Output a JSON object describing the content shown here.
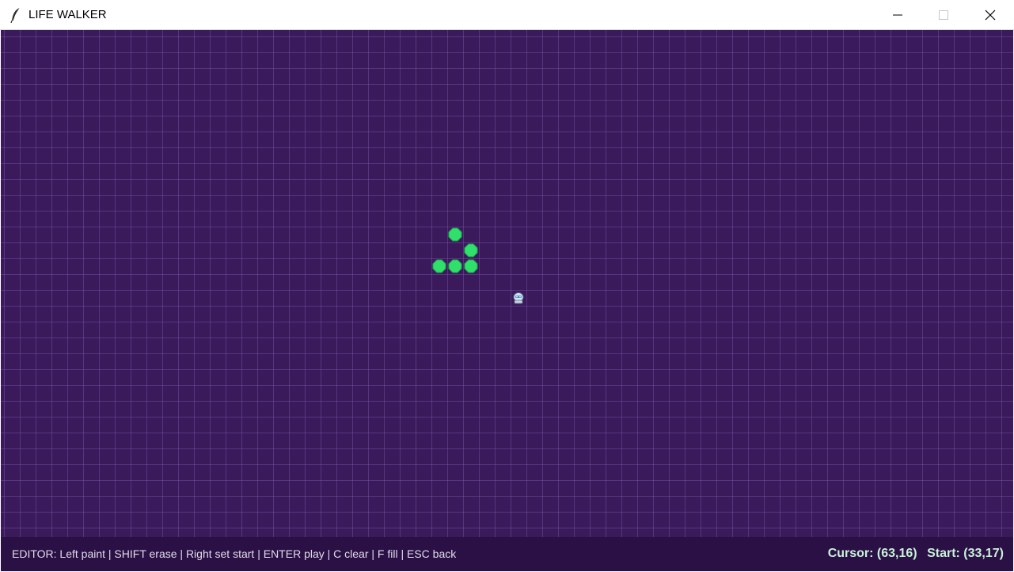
{
  "window": {
    "title": "LIFE WALKER",
    "app_icon": "feather-icon",
    "controls": [
      "minimize-icon",
      "maximize-icon",
      "close-icon"
    ]
  },
  "canvas": {
    "background_color": "#3b1a5c",
    "grid_color": "#5b3a80",
    "cell_color": "#2fe06a",
    "player_icon": "player-sprite-icon",
    "live_cells": [
      {
        "col": 28,
        "row": 12
      },
      {
        "col": 29,
        "row": 13
      },
      {
        "col": 27,
        "row": 14
      },
      {
        "col": 28,
        "row": 14
      },
      {
        "col": 29,
        "row": 14
      }
    ],
    "player_cell": {
      "col": 32,
      "row": 16
    }
  },
  "status": {
    "help": "EDITOR: Left paint | SHIFT erase | Right set start | ENTER play | C clear | F fill | ESC back",
    "cursor": "Cursor: (63,16)",
    "start": "Start: (33,17)"
  }
}
